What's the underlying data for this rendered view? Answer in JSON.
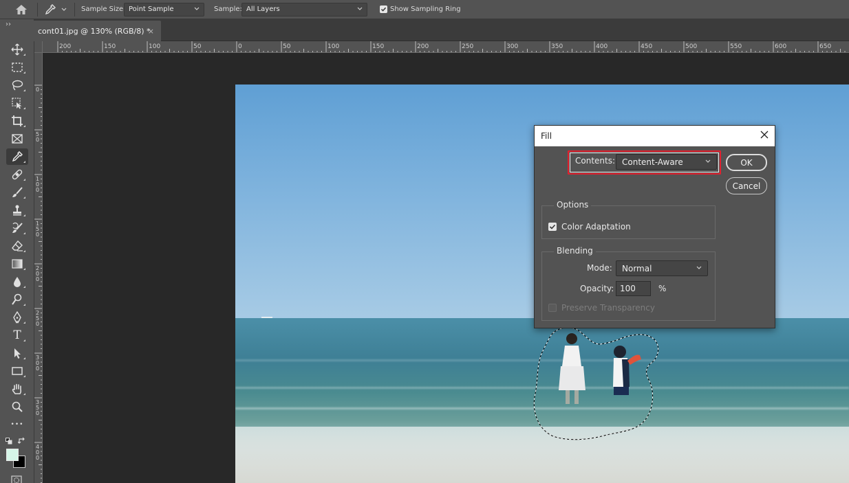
{
  "options_bar": {
    "home_icon": "home-icon",
    "tool_icon": "eyedropper-icon",
    "sample_size_label": "Sample Size:",
    "sample_size_value": "Point Sample",
    "sample_label": "Sample:",
    "sample_value": "All Layers",
    "show_sampling_ring_label": "Show Sampling Ring",
    "show_sampling_ring_checked": true
  },
  "document_tab": {
    "title": "cont01.jpg @ 130% (RGB/8) *",
    "close_glyph": "×"
  },
  "ruler_top": {
    "labels": [
      "200",
      "150",
      "100",
      "50",
      "0",
      "50",
      "100",
      "150",
      "200",
      "250",
      "300",
      "350",
      "400",
      "450",
      "500",
      "550",
      "600",
      "650"
    ]
  },
  "ruler_left": {
    "labels": [
      "0",
      "50",
      "100",
      "150",
      "200",
      "250",
      "300",
      "350",
      "400"
    ]
  },
  "tools": [
    {
      "name": "move-tool",
      "icon": "move-icon"
    },
    {
      "name": "marquee-tool",
      "icon": "rect-marquee-icon"
    },
    {
      "name": "lasso-tool",
      "icon": "lasso-icon"
    },
    {
      "name": "object-select-tool",
      "icon": "object-select-icon"
    },
    {
      "name": "crop-tool",
      "icon": "crop-icon"
    },
    {
      "name": "frame-tool",
      "icon": "frame-icon"
    },
    {
      "name": "eyedropper-tool",
      "icon": "eyedropper-icon",
      "active": true
    },
    {
      "name": "healing-tool",
      "icon": "bandage-icon"
    },
    {
      "name": "brush-tool",
      "icon": "brush-icon"
    },
    {
      "name": "stamp-tool",
      "icon": "stamp-icon"
    },
    {
      "name": "history-brush-tool",
      "icon": "history-brush-icon"
    },
    {
      "name": "eraser-tool",
      "icon": "eraser-icon"
    },
    {
      "name": "gradient-tool",
      "icon": "gradient-icon"
    },
    {
      "name": "blur-tool",
      "icon": "drop-icon"
    },
    {
      "name": "dodge-tool",
      "icon": "dodge-icon"
    },
    {
      "name": "pen-tool",
      "icon": "pen-icon"
    },
    {
      "name": "type-tool",
      "icon": "type-icon",
      "glyph": "T"
    },
    {
      "name": "path-select-tool",
      "icon": "arrow-icon"
    },
    {
      "name": "shape-tool",
      "icon": "rectangle-icon"
    },
    {
      "name": "hand-tool",
      "icon": "hand-icon"
    },
    {
      "name": "zoom-tool",
      "icon": "zoom-icon"
    },
    {
      "name": "more-tools",
      "icon": "ellipsis-icon",
      "glyph": "•••"
    }
  ],
  "colors": {
    "foreground": "#d5f5e7",
    "background": "#000000",
    "highlight": "#e2212f"
  },
  "fill_dialog": {
    "title": "Fill",
    "contents_label": "Contents:",
    "contents_value": "Content-Aware",
    "ok_label": "OK",
    "cancel_label": "Cancel",
    "options_title": "Options",
    "color_adaptation_label": "Color Adaptation",
    "color_adaptation_checked": true,
    "blending_title": "Blending",
    "mode_label": "Mode:",
    "mode_value": "Normal",
    "opacity_label": "Opacity:",
    "opacity_value": "100",
    "opacity_unit": "%",
    "preserve_transparency_label": "Preserve Transparency",
    "preserve_transparency_checked": false
  }
}
